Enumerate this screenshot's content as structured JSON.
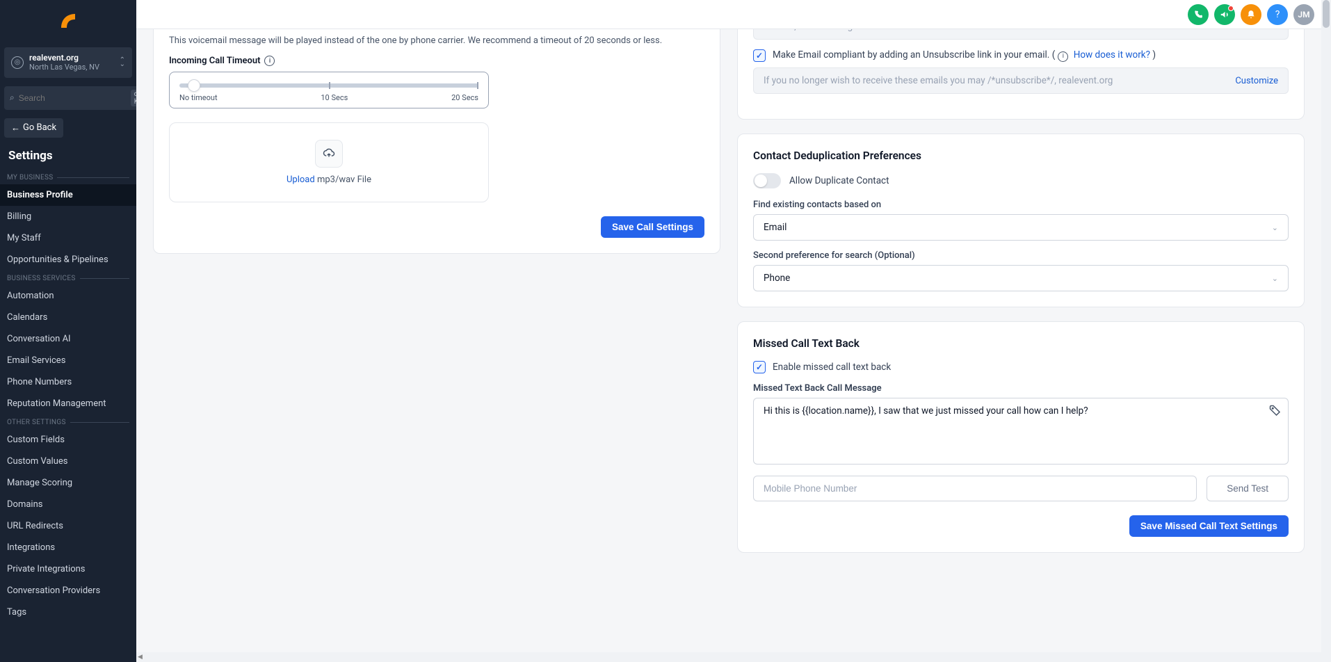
{
  "sidebar": {
    "location": {
      "name": "realevent.org",
      "sub": "North Las Vegas, NV"
    },
    "search_placeholder": "Search",
    "search_kbd": "ctrl K",
    "go_back": "Go Back",
    "settings_heading": "Settings",
    "sections": [
      {
        "label": "MY BUSINESS",
        "items": [
          "Business Profile",
          "Billing",
          "My Staff",
          "Opportunities & Pipelines"
        ]
      },
      {
        "label": "BUSINESS SERVICES",
        "items": [
          "Automation",
          "Calendars",
          "Conversation AI",
          "Email Services",
          "Phone Numbers",
          "Reputation Management"
        ]
      },
      {
        "label": "OTHER SETTINGS",
        "items": [
          "Custom Fields",
          "Custom Values",
          "Manage Scoring",
          "Domains",
          "URL Redirects",
          "Integrations",
          "Private Integrations",
          "Conversation Providers",
          "Tags"
        ]
      }
    ],
    "active": "Business Profile"
  },
  "topbar": {
    "avatar_initials": "JM"
  },
  "left_panel": {
    "voicemail_help": "This voicemail message will be played instead of the one by phone carrier. We recommend a timeout of 20 seconds or less.",
    "timeout_label": "Incoming Call Timeout",
    "slider": {
      "left": "No timeout",
      "mid": "10 Secs",
      "right": "20 Secs"
    },
    "upload_link": "Upload",
    "upload_rest": " mp3/wav File",
    "save_btn": "Save Call Settings"
  },
  "email_compliance": {
    "field1_placeholder": "Thanks, realevent.org",
    "customize": "Customize",
    "unsub_label": "Make Email compliant by adding an Unsubscribe link in your email.  (",
    "how_link": "How does it work?",
    "unsub_paren_close": " )",
    "field2_placeholder": "If you no longer wish to receive these emails you may /*unsubscribe*/, realevent.org"
  },
  "dedup": {
    "title": "Contact Deduplication Preferences",
    "toggle_label": "Allow Duplicate Contact",
    "find_label": "Find existing contacts based on",
    "find_value": "Email",
    "second_label": "Second preference for search (Optional)",
    "second_value": "Phone"
  },
  "missed": {
    "title": "Missed Call Text Back",
    "enable_label": "Enable missed call text back",
    "msg_label": "Missed Text Back Call Message",
    "msg_value": "Hi this is {{location.name}}, I saw that we just missed your call how can I help?",
    "phone_placeholder": "Mobile Phone Number",
    "send_test": "Send Test",
    "save_btn": "Save Missed Call Text Settings"
  }
}
